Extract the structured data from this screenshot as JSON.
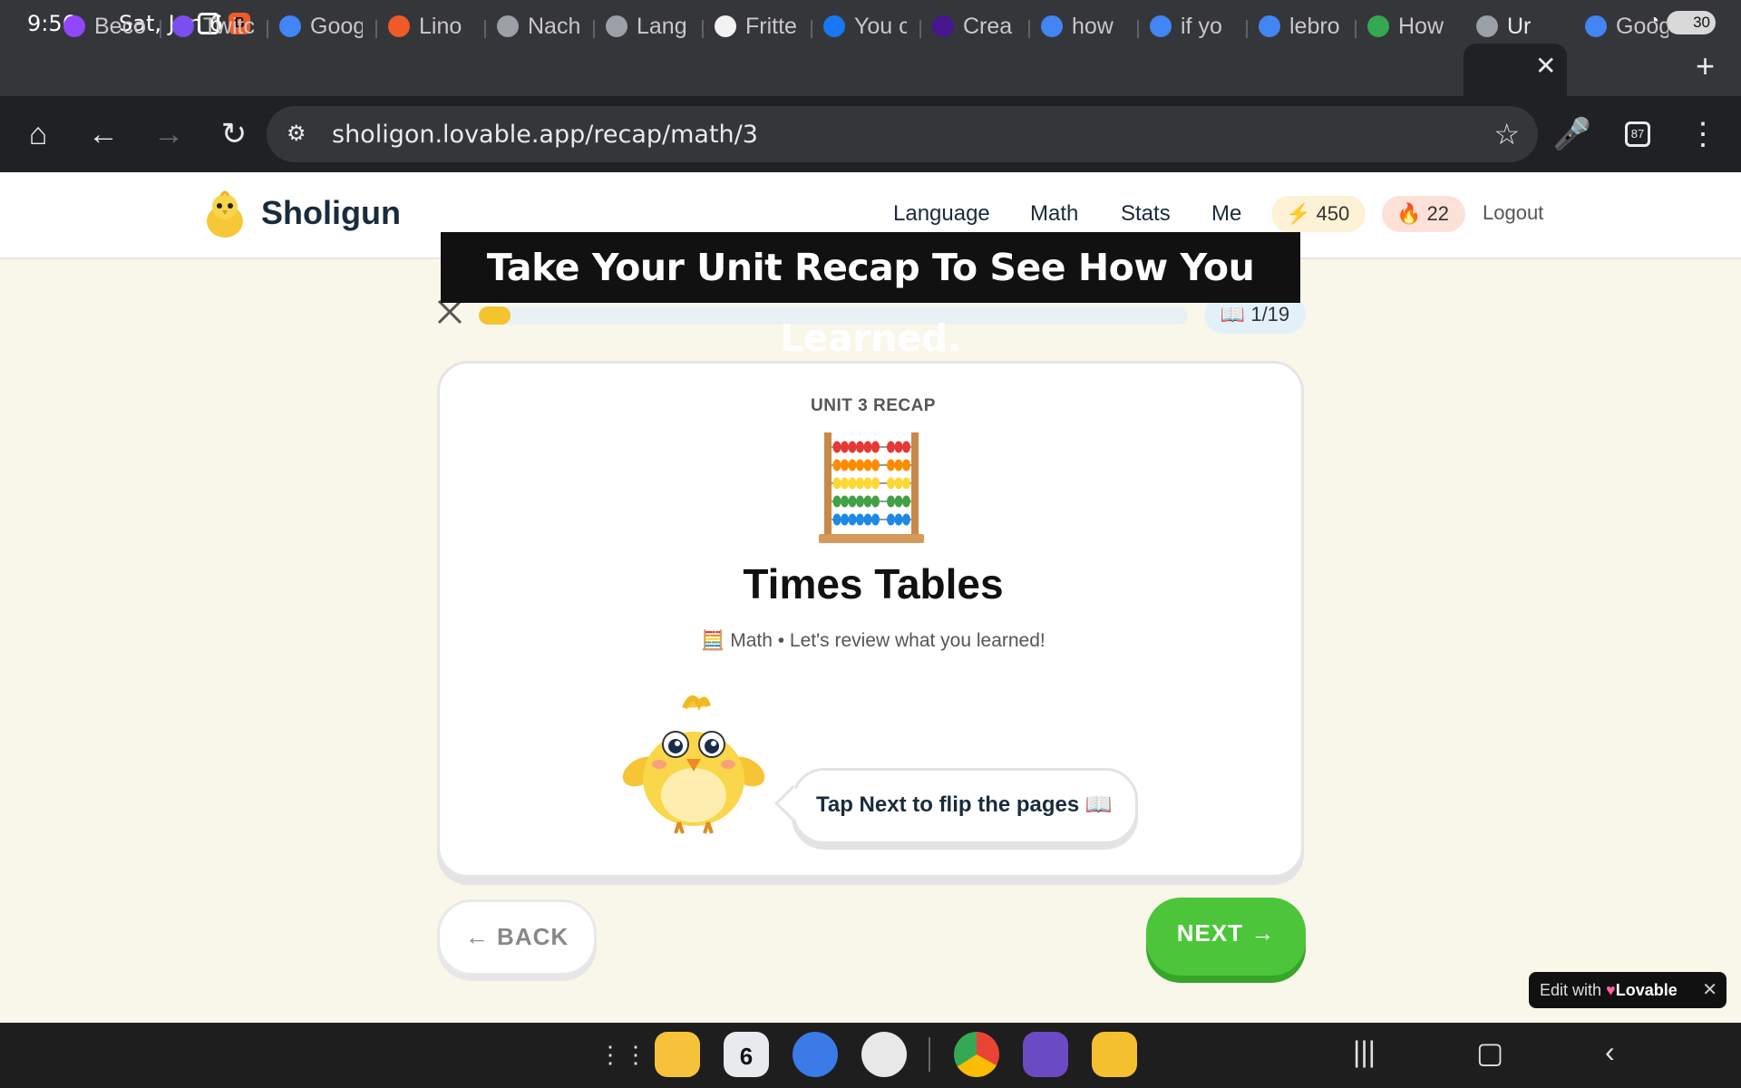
{
  "status_bar": {
    "time": "9:56",
    "date": "Sat, Jun 6",
    "battery": "30"
  },
  "tabs": [
    {
      "label": "Beco",
      "icon": "twitch-icon",
      "color": "#9146ff"
    },
    {
      "label": "Twitc",
      "icon": "twitch-list-icon",
      "color": "#7b4ef0"
    },
    {
      "label": "Goog",
      "icon": "google-icon",
      "color": "#4285f4"
    },
    {
      "label": "Lino",
      "icon": "lino-icon",
      "color": "#f05a28"
    },
    {
      "label": "Nach",
      "icon": "globe-icon",
      "color": "#9aa0a6"
    },
    {
      "label": "Lang",
      "icon": "globe-icon",
      "color": "#9aa0a6"
    },
    {
      "label": "Fritte",
      "icon": "fritter-icon",
      "color": "#f2f2f2"
    },
    {
      "label": "You c",
      "icon": "facebook-icon",
      "color": "#1877f2"
    },
    {
      "label": "Crea",
      "icon": "kahoot-icon",
      "color": "#46178f"
    },
    {
      "label": "how",
      "icon": "google-icon",
      "color": "#4285f4"
    },
    {
      "label": "if yo",
      "icon": "google-icon",
      "color": "#4285f4"
    },
    {
      "label": "lebro",
      "icon": "google-icon",
      "color": "#4285f4"
    },
    {
      "label": "How",
      "icon": "google-color-icon",
      "color": "#34a853"
    },
    {
      "label": "Ur",
      "icon": "globe-icon",
      "color": "#9aa0a6",
      "active": true
    },
    {
      "label": "Goog",
      "icon": "google-icon",
      "color": "#4285f4"
    }
  ],
  "toolbar": {
    "url": "sholigon.lovable.app/recap/math/3",
    "tab_count": "87"
  },
  "app": {
    "brand": "Sholigun",
    "nav": [
      "Language",
      "Math",
      "Stats",
      "Me"
    ],
    "xp": "⚡ 450",
    "streak": "🔥 22",
    "logout": "Logout"
  },
  "banner": "Take Your Unit Recap To See How You Learned.",
  "progress": {
    "fraction": 0.045,
    "page_label": "📖 1/19"
  },
  "card": {
    "unit_label": "UNIT 3 RECAP",
    "title": "Times Tables",
    "subtitle": "🧮 Math • Let's review what you learned!",
    "bubble": "Tap Next to flip the pages 📖"
  },
  "buttons": {
    "back": "← BACK",
    "next": "NEXT →"
  },
  "lovable": {
    "prefix": "Edit with",
    "brand": "Lovable"
  },
  "colors": {
    "accent_green": "#4cc53a",
    "progress_yellow": "#f4c430",
    "background": "#f8f7ea"
  }
}
